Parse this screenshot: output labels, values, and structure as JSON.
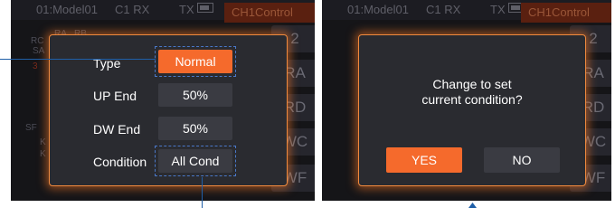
{
  "status_bar": {
    "model": "01:Model01",
    "rx": "C1 RX",
    "tx": "TX",
    "channel_control": "CH1Control"
  },
  "background": {
    "left_tiles": [
      "2",
      "RA",
      "RD",
      "WC",
      "WF"
    ],
    "left_side_labels": [
      "RC",
      "SA",
      "3",
      "SF",
      "K",
      "K",
      "RA",
      "RB"
    ],
    "right_tiles": [
      "2",
      "RA",
      "RD",
      "WC",
      "WF"
    ]
  },
  "left_dialog": {
    "rows": [
      {
        "label": "Type",
        "value": "Normal"
      },
      {
        "label": "UP End",
        "value": "50%"
      },
      {
        "label": "DW End",
        "value": "50%"
      },
      {
        "label": "Condition",
        "value": "All Cond"
      }
    ]
  },
  "right_dialog": {
    "message_line1": "Change to set",
    "message_line2": "current condition?",
    "yes_label": "YES",
    "no_label": "NO"
  },
  "colors": {
    "accent": "#f56a2c",
    "dialog_border": "#f08a3e",
    "screen_bg": "#151518",
    "callout": "#1f5fa8"
  }
}
